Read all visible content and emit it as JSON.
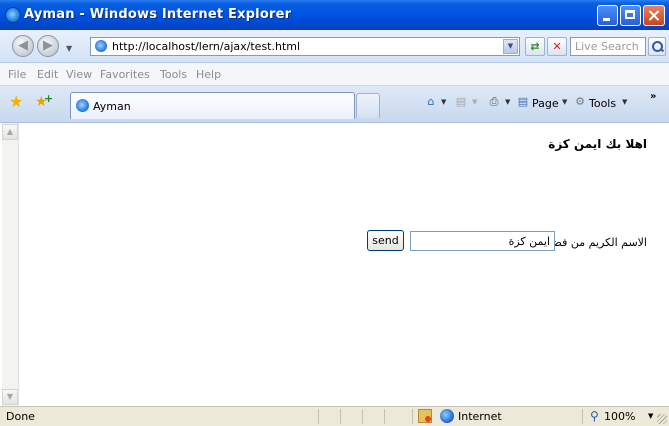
{
  "window": {
    "title": "Ayman - Windows Internet Explorer"
  },
  "address_bar": {
    "url": "http://localhost/lern/ajax/test.html",
    "search_placeholder": "Live Search"
  },
  "menu": [
    "File",
    "Edit",
    "View",
    "Favorites",
    "Tools",
    "Help"
  ],
  "tabs": [
    {
      "label": "Ayman"
    }
  ],
  "command_bar": {
    "page_label": "Page",
    "tools_label": "Tools"
  },
  "page": {
    "heading": "اهلا بك ايمن كزة",
    "name_label": "الاسم الكريم من فضلك",
    "name_input_value": "ايمن كزة",
    "send_label": "send"
  },
  "status_bar": {
    "status": "Done",
    "zone": "Internet",
    "zoom": "100%"
  },
  "icons": {
    "ie_logo": "ie-logo-icon",
    "back": "back-arrow-icon",
    "forward": "forward-arrow-icon",
    "refresh": "refresh-icon",
    "stop": "stop-icon",
    "search": "search-icon",
    "favorites": "favorites-star-icon",
    "add_favorites": "add-favorites-icon",
    "home": "home-icon",
    "feeds": "feeds-icon",
    "print": "print-icon",
    "page": "page-icon",
    "tools": "gear-icon",
    "zone": "security-zone-icon",
    "globe": "globe-icon",
    "zoom": "zoom-icon"
  },
  "colors": {
    "titlebar": "#0054e3",
    "content_bg": "#ffffff",
    "chrome": "#ece9d8"
  }
}
